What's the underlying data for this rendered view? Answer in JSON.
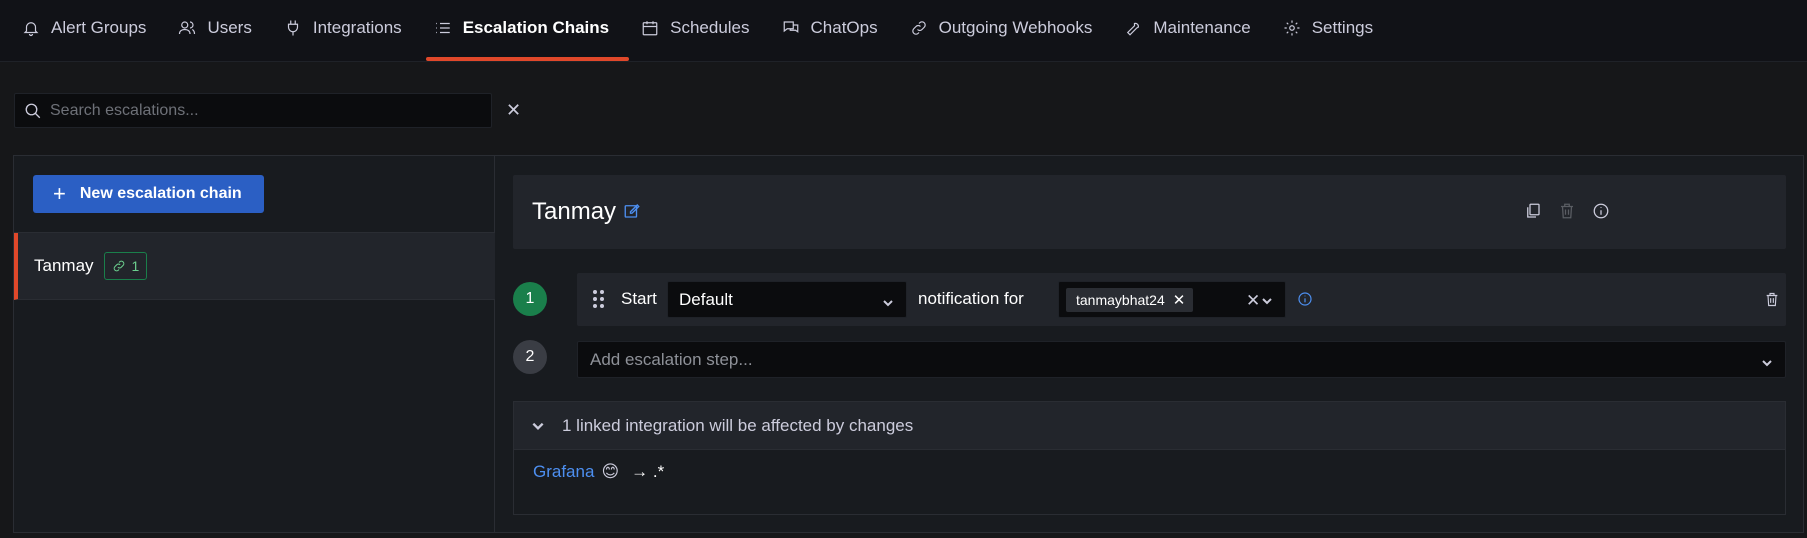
{
  "tabs": [
    {
      "label": "Alert Groups",
      "icon": "bell-icon",
      "active": false
    },
    {
      "label": "Users",
      "icon": "users-icon",
      "active": false
    },
    {
      "label": "Integrations",
      "icon": "plug-icon",
      "active": false
    },
    {
      "label": "Escalation Chains",
      "icon": "list-icon",
      "active": true
    },
    {
      "label": "Schedules",
      "icon": "calendar-icon",
      "active": false
    },
    {
      "label": "ChatOps",
      "icon": "chat-icon",
      "active": false
    },
    {
      "label": "Outgoing Webhooks",
      "icon": "link-icon",
      "active": false
    },
    {
      "label": "Maintenance",
      "icon": "wrench-icon",
      "active": false
    },
    {
      "label": "Settings",
      "icon": "gear-icon",
      "active": false
    }
  ],
  "search": {
    "placeholder": "Search escalations...",
    "value": ""
  },
  "sidebar": {
    "new_button_label": "New escalation chain",
    "chains": [
      {
        "name": "Tanmay",
        "linked_count": "1",
        "selected": true
      }
    ]
  },
  "chain": {
    "title": "Tanmay",
    "steps": [
      {
        "number": "1",
        "start_label": "Start",
        "notify_type": "Default",
        "notification_for_label": "notification for",
        "users": [
          "tanmaybhat24"
        ]
      }
    ],
    "add_step": {
      "number": "2",
      "placeholder": "Add escalation step..."
    }
  },
  "linked": {
    "header": "1 linked integration will be affected by changes",
    "integration_name": "Grafana",
    "integration_emoji": "😊",
    "route": "→ .*"
  },
  "colors": {
    "accent": "#e0482a",
    "primary_button": "#2b5fc4",
    "step1": "#1a7f4b",
    "step2": "#3a3d44",
    "link": "#4d8ff0"
  }
}
